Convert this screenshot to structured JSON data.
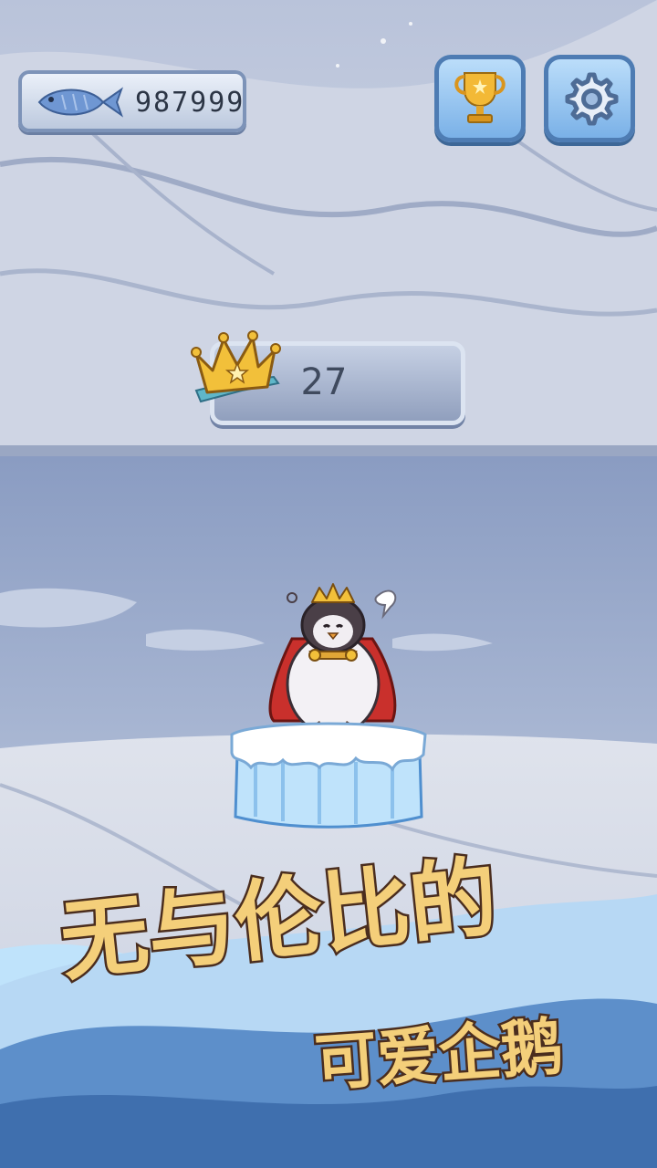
{
  "hud": {
    "fish_count": "987999",
    "fish_icon": "fish-icon",
    "trophy_icon": "trophy-icon",
    "settings_icon": "gear-icon"
  },
  "score": {
    "value": "27",
    "icon": "crown-icon"
  },
  "character": {
    "name_icon": "penguin-king-icon"
  },
  "slogan": {
    "line1": "无与伦比的",
    "line2": "可爱企鹅"
  },
  "colors": {
    "slogan_fill": "#f4cf7a",
    "slogan_outline": "#4a2d1e",
    "button_blue": "#76aee6",
    "ice_blue": "#bfe3fb"
  }
}
